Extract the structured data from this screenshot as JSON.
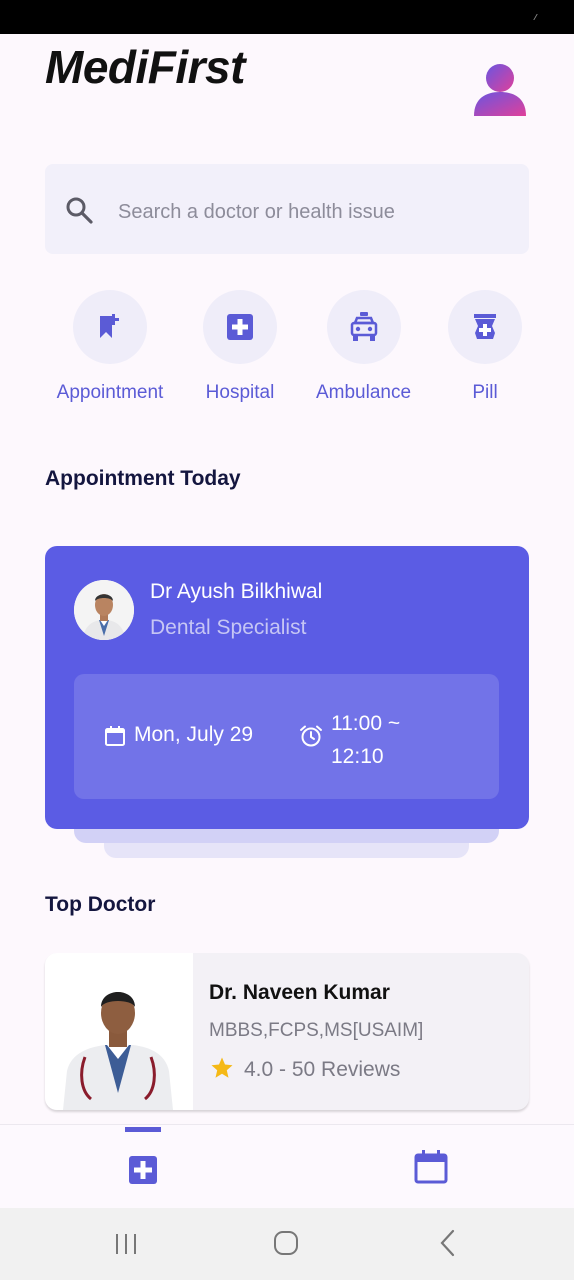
{
  "header": {
    "title": "MediFirst"
  },
  "search": {
    "placeholder": "Search a doctor or health issue"
  },
  "categories": [
    {
      "label": "Appointment",
      "icon": "bookmark-add-icon"
    },
    {
      "label": "Hospital",
      "icon": "hospital-cross-icon"
    },
    {
      "label": "Ambulance",
      "icon": "ambulance-icon"
    },
    {
      "label": "Pill",
      "icon": "medicine-icon"
    }
  ],
  "appointment_today": {
    "section_title": "Appointment Today",
    "doctor_name": "Dr Ayush Bilkhiwal",
    "specialty": "Dental Specialist",
    "date": "Mon, July 29",
    "time": "11:00 ~ 12:10"
  },
  "top_doctor": {
    "section_title": "Top Doctor",
    "name": "Dr. Naveen Kumar",
    "credentials": "MBBS,FCPS,MS[USAIM]",
    "rating": "4.0 - 50 Reviews"
  },
  "colors": {
    "accent": "#5B5CE4",
    "accent_light": "#7273E8",
    "star": "#F5B916",
    "title": "#14163F"
  }
}
